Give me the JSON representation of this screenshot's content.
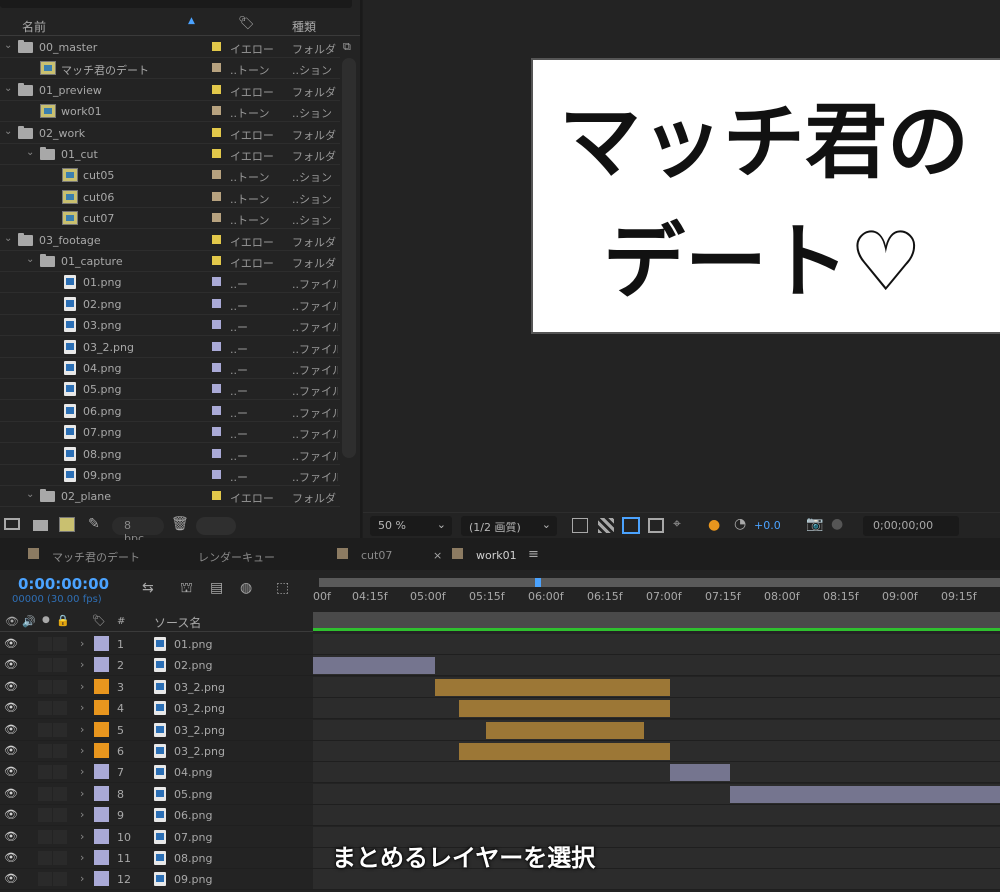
{
  "project": {
    "headers": {
      "name": "名前",
      "type": "種類"
    },
    "rows": [
      {
        "level": 0,
        "kind": "folder",
        "name": "00_master",
        "swatch": "#e2c84a",
        "label": "イエロー",
        "type": "フォルダ",
        "open": true
      },
      {
        "level": 1,
        "kind": "comp",
        "name": "マッチ君のデート",
        "swatch": "#b7a27f",
        "label": "..トーン",
        "type": "..ション"
      },
      {
        "level": 0,
        "kind": "folder",
        "name": "01_preview",
        "swatch": "#e2c84a",
        "label": "イエロー",
        "type": "フォルダ",
        "open": true
      },
      {
        "level": 1,
        "kind": "comp",
        "name": "work01",
        "swatch": "#b7a27f",
        "label": "..トーン",
        "type": "..ション"
      },
      {
        "level": 0,
        "kind": "folder",
        "name": "02_work",
        "swatch": "#e2c84a",
        "label": "イエロー",
        "type": "フォルダ",
        "open": true
      },
      {
        "level": 1,
        "kind": "folder",
        "name": "01_cut",
        "swatch": "#e2c84a",
        "label": "イエロー",
        "type": "フォルダ",
        "open": true
      },
      {
        "level": 2,
        "kind": "comp",
        "name": "cut05",
        "swatch": "#b7a27f",
        "label": "..トーン",
        "type": "..ション"
      },
      {
        "level": 2,
        "kind": "comp",
        "name": "cut06",
        "swatch": "#b7a27f",
        "label": "..トーン",
        "type": "..ション"
      },
      {
        "level": 2,
        "kind": "comp",
        "name": "cut07",
        "swatch": "#b7a27f",
        "label": "..トーン",
        "type": "..ション"
      },
      {
        "level": 0,
        "kind": "folder",
        "name": "03_footage",
        "swatch": "#e2c84a",
        "label": "イエロー",
        "type": "フォルダ",
        "open": true
      },
      {
        "level": 1,
        "kind": "folder",
        "name": "01_capture",
        "swatch": "#e2c84a",
        "label": "イエロー",
        "type": "フォルダ",
        "open": true
      },
      {
        "level": 2,
        "kind": "png",
        "name": "01.png",
        "swatch": "#a9a9d6",
        "label": "..ー",
        "type": "..ファイル"
      },
      {
        "level": 2,
        "kind": "png",
        "name": "02.png",
        "swatch": "#a9a9d6",
        "label": "..ー",
        "type": "..ファイル"
      },
      {
        "level": 2,
        "kind": "png",
        "name": "03.png",
        "swatch": "#a9a9d6",
        "label": "..ー",
        "type": "..ファイル"
      },
      {
        "level": 2,
        "kind": "png",
        "name": "03_2.png",
        "swatch": "#a9a9d6",
        "label": "..ー",
        "type": "..ファイル"
      },
      {
        "level": 2,
        "kind": "png",
        "name": "04.png",
        "swatch": "#a9a9d6",
        "label": "..ー",
        "type": "..ファイル"
      },
      {
        "level": 2,
        "kind": "png",
        "name": "05.png",
        "swatch": "#a9a9d6",
        "label": "..ー",
        "type": "..ファイル"
      },
      {
        "level": 2,
        "kind": "png",
        "name": "06.png",
        "swatch": "#a9a9d6",
        "label": "..ー",
        "type": "..ファイル"
      },
      {
        "level": 2,
        "kind": "png",
        "name": "07.png",
        "swatch": "#a9a9d6",
        "label": "..ー",
        "type": "..ファイル"
      },
      {
        "level": 2,
        "kind": "png",
        "name": "08.png",
        "swatch": "#a9a9d6",
        "label": "..ー",
        "type": "..ファイル"
      },
      {
        "level": 2,
        "kind": "png",
        "name": "09.png",
        "swatch": "#a9a9d6",
        "label": "..ー",
        "type": "..ファイル"
      },
      {
        "level": 1,
        "kind": "folder",
        "name": "02_plane",
        "swatch": "#e2c84a",
        "label": "イエロー",
        "type": "フォルダ",
        "open": true
      }
    ],
    "bpc": "8 bpc"
  },
  "viewer": {
    "canvas_text_line1": "マッチ君の",
    "canvas_text_line2": "デート♡",
    "zoom": "50 %",
    "resolution": "(1/2 画質)",
    "exposure": "+0.0",
    "timecode": "0;00;00;00"
  },
  "tabs": [
    {
      "label": "マッチ君のデート",
      "swatch": "#8c7b62"
    },
    {
      "label": "レンダーキュー",
      "swatch": ""
    },
    {
      "label": "cut07",
      "swatch": "#8c7b62"
    },
    {
      "label": "work01",
      "swatch": "#8c7b62",
      "active": true
    }
  ],
  "timeline": {
    "timecode": "0:00:00:00",
    "frames": "00000 (30.00 fps)",
    "col_source": "ソース名",
    "col_hash": "#",
    "ticks": [
      "00f",
      "04:15f",
      "05:00f",
      "05:15f",
      "06:00f",
      "06:15f",
      "07:00f",
      "07:15f",
      "08:00f",
      "08:15f",
      "09:00f",
      "09:15f"
    ],
    "layers": [
      {
        "num": "1",
        "name": "01.png",
        "color": "#a9a9d6",
        "bar": null
      },
      {
        "num": "2",
        "name": "02.png",
        "color": "#a9a9d6",
        "bar": [
          0,
          0.178
        ],
        "bar_color": "#75758f"
      },
      {
        "num": "3",
        "name": "03_2.png",
        "color": "#e8961e",
        "bar": [
          0.178,
          0.52
        ],
        "bar_color": "#9c7736"
      },
      {
        "num": "4",
        "name": "03_2.png",
        "color": "#e8961e",
        "bar": [
          0.213,
          0.52
        ],
        "bar_color": "#9c7736"
      },
      {
        "num": "5",
        "name": "03_2.png",
        "color": "#e8961e",
        "bar": [
          0.252,
          0.482
        ],
        "bar_color": "#9c7736"
      },
      {
        "num": "6",
        "name": "03_2.png",
        "color": "#e8961e",
        "bar": [
          0.213,
          0.52
        ],
        "bar_color": "#9c7736"
      },
      {
        "num": "7",
        "name": "04.png",
        "color": "#a9a9d6",
        "bar": [
          0.52,
          0.607
        ],
        "bar_color": "#75758f"
      },
      {
        "num": "8",
        "name": "05.png",
        "color": "#a9a9d6",
        "bar": [
          0.607,
          1
        ],
        "bar_color": "#75758f"
      },
      {
        "num": "9",
        "name": "06.png",
        "color": "#a9a9d6",
        "bar": null
      },
      {
        "num": "10",
        "name": "07.png",
        "color": "#a9a9d6",
        "bar": null
      },
      {
        "num": "11",
        "name": "08.png",
        "color": "#a9a9d6",
        "bar": null
      },
      {
        "num": "12",
        "name": "09.png",
        "color": "#a9a9d6",
        "bar": null
      }
    ]
  },
  "caption": "まとめるレイヤーを選択"
}
